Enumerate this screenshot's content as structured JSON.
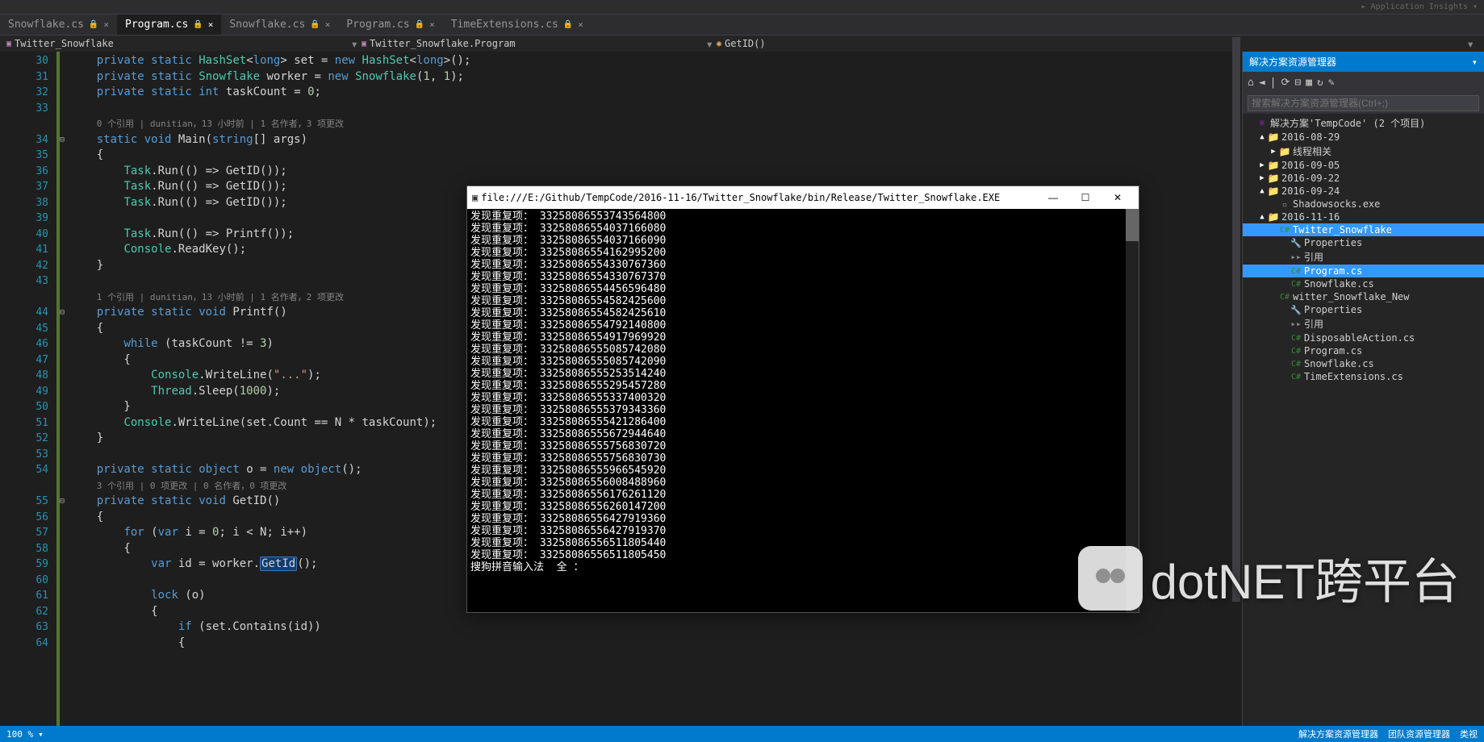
{
  "top_hint": "▸ Application Insights ▾",
  "tabs": [
    {
      "label": "Snowflake.cs",
      "active": false,
      "locked": true
    },
    {
      "label": "Program.cs",
      "active": true,
      "locked": true
    },
    {
      "label": "Snowflake.cs",
      "active": false,
      "locked": true
    },
    {
      "label": "Program.cs",
      "active": false,
      "locked": true
    },
    {
      "label": "TimeExtensions.cs",
      "active": false,
      "locked": true
    }
  ],
  "breadcrumb": {
    "left": "Twitter_Snowflake",
    "mid": "Twitter_Snowflake.Program",
    "right": "GetID()"
  },
  "code_lines": [
    {
      "n": 30,
      "html": "    <span class='kw'>private</span> <span class='kw'>static</span> <span class='type'>HashSet</span>&lt;<span class='kw'>long</span>&gt; set = <span class='kw'>new</span> <span class='type'>HashSet</span>&lt;<span class='kw'>long</span>&gt;();"
    },
    {
      "n": 31,
      "html": "    <span class='kw'>private</span> <span class='kw'>static</span> <span class='type'>Snowflake</span> worker = <span class='kw'>new</span> <span class='type'>Snowflake</span>(<span class='num'>1</span>, <span class='num'>1</span>);"
    },
    {
      "n": 32,
      "html": "    <span class='kw'>private</span> <span class='kw'>static</span> <span class='kw'>int</span> taskCount = <span class='num'>0</span>;"
    },
    {
      "n": 33,
      "html": ""
    },
    {
      "n": 0,
      "html": "    <span class='codelens'>0 个引用 | dunitian，13 小时前 | 1 名作者，3 项更改</span>"
    },
    {
      "n": 34,
      "html": "    <span class='kw'>static</span> <span class='kw'>void</span> Main(<span class='kw'>string</span>[] args)",
      "fold": "⊟"
    },
    {
      "n": 35,
      "html": "    {"
    },
    {
      "n": 36,
      "html": "        <span class='type'>Task</span>.Run(() =&gt; GetID());"
    },
    {
      "n": 37,
      "html": "        <span class='type'>Task</span>.Run(() =&gt; GetID());"
    },
    {
      "n": 38,
      "html": "        <span class='type'>Task</span>.Run(() =&gt; GetID());"
    },
    {
      "n": 39,
      "html": ""
    },
    {
      "n": 40,
      "html": "        <span class='type'>Task</span>.Run(() =&gt; Printf());"
    },
    {
      "n": 41,
      "html": "        <span class='type'>Console</span>.ReadKey();"
    },
    {
      "n": 42,
      "html": "    }"
    },
    {
      "n": 43,
      "html": ""
    },
    {
      "n": 0,
      "html": "    <span class='codelens'>1 个引用 | dunitian，13 小时前 | 1 名作者，2 项更改</span>"
    },
    {
      "n": 44,
      "html": "    <span class='kw'>private</span> <span class='kw'>static</span> <span class='kw'>void</span> Printf()",
      "fold": "⊟"
    },
    {
      "n": 45,
      "html": "    {"
    },
    {
      "n": 46,
      "html": "        <span class='kw'>while</span> (taskCount != <span class='num'>3</span>)"
    },
    {
      "n": 47,
      "html": "        {"
    },
    {
      "n": 48,
      "html": "            <span class='type'>Console</span>.WriteLine(<span class='str'>\"...\"</span>);"
    },
    {
      "n": 49,
      "html": "            <span class='type'>Thread</span>.Sleep(<span class='num'>1000</span>);"
    },
    {
      "n": 50,
      "html": "        }"
    },
    {
      "n": 51,
      "html": "        <span class='type'>Console</span>.WriteLine(set.Count == N * taskCount);"
    },
    {
      "n": 52,
      "html": "    }"
    },
    {
      "n": 53,
      "html": ""
    },
    {
      "n": 54,
      "html": "    <span class='kw'>private</span> <span class='kw'>static</span> <span class='kw'>object</span> o = <span class='kw'>new</span> <span class='kw'>object</span>();"
    },
    {
      "n": 0,
      "html": "    <span class='codelens'>3 个引用 | 0 项更改 | 0 名作者，0 项更改</span>"
    },
    {
      "n": 55,
      "html": "    <span class='kw'>private</span> <span class='kw'>static</span> <span class='kw'>void</span> GetID()",
      "fold": "⊟"
    },
    {
      "n": 56,
      "html": "    {"
    },
    {
      "n": 57,
      "html": "        <span class='kw'>for</span> (<span class='kw'>var</span> i = <span class='num'>0</span>; i &lt; N; i++)"
    },
    {
      "n": 58,
      "html": "        {"
    },
    {
      "n": 59,
      "html": "            <span class='kw'>var</span> id = worker.<span class='hl'>GetId</span>();"
    },
    {
      "n": 60,
      "html": ""
    },
    {
      "n": 61,
      "html": "            <span class='kw'>lock</span> (o)"
    },
    {
      "n": 62,
      "html": "            {"
    },
    {
      "n": 63,
      "html": "                <span class='kw'>if</span> (set.Contains(id))"
    },
    {
      "n": 64,
      "html": "                {"
    }
  ],
  "solution_panel": {
    "title": "解决方案资源管理器",
    "search_placeholder": "搜索解决方案资源管理器(Ctrl+;)",
    "tree": [
      {
        "depth": 0,
        "exp": "",
        "icon": "sln",
        "label": "解决方案'TempCode' (2 个项目)"
      },
      {
        "depth": 1,
        "exp": "▲",
        "icon": "folder",
        "label": "2016-08-29"
      },
      {
        "depth": 2,
        "exp": "▶",
        "icon": "folder",
        "label": "线程相关"
      },
      {
        "depth": 1,
        "exp": "▶",
        "icon": "folder",
        "label": "2016-09-05"
      },
      {
        "depth": 1,
        "exp": "▶",
        "icon": "folder",
        "label": "2016-09-22"
      },
      {
        "depth": 1,
        "exp": "▲",
        "icon": "folder",
        "label": "2016-09-24"
      },
      {
        "depth": 2,
        "exp": "",
        "icon": "file",
        "label": "Shadowsocks.exe"
      },
      {
        "depth": 1,
        "exp": "▲",
        "icon": "folder",
        "label": "2016-11-16"
      },
      {
        "depth": 2,
        "exp": "",
        "icon": "proj",
        "label": "Twitter_Snowflake",
        "sel": true
      },
      {
        "depth": 3,
        "exp": "",
        "icon": "wrench",
        "label": "Properties"
      },
      {
        "depth": 3,
        "exp": "",
        "icon": "ref",
        "label": "引用"
      },
      {
        "depth": 3,
        "exp": "",
        "icon": "cs",
        "label": "Program.cs",
        "sel2": true
      },
      {
        "depth": 3,
        "exp": "",
        "icon": "cs",
        "label": "Snowflake.cs"
      },
      {
        "depth": 2,
        "exp": "",
        "icon": "proj",
        "label": "witter_Snowflake_New"
      },
      {
        "depth": 3,
        "exp": "",
        "icon": "wrench",
        "label": "Properties"
      },
      {
        "depth": 3,
        "exp": "",
        "icon": "ref",
        "label": "引用"
      },
      {
        "depth": 3,
        "exp": "",
        "icon": "cs",
        "label": "DisposableAction.cs"
      },
      {
        "depth": 3,
        "exp": "",
        "icon": "cs",
        "label": "Program.cs"
      },
      {
        "depth": 3,
        "exp": "",
        "icon": "cs",
        "label": "Snowflake.cs"
      },
      {
        "depth": 3,
        "exp": "",
        "icon": "cs",
        "label": "TimeExtensions.cs"
      }
    ]
  },
  "console": {
    "title": "file:///E:/Github/TempCode/2016-11-16/Twitter_Snowflake/bin/Release/Twitter_Snowflake.EXE",
    "prefix": "发现重复项：",
    "ids": [
      "33258086553743564800",
      "33258086554037166080",
      "33258086554037166090",
      "33258086554162995200",
      "33258086554330767360",
      "33258086554330767370",
      "33258086554456596480",
      "33258086554582425600",
      "33258086554582425610",
      "33258086554792140800",
      "33258086554917969920",
      "33258086555085742080",
      "33258086555085742090",
      "33258086555253514240",
      "33258086555295457280",
      "33258086555337400320",
      "33258086555379343360",
      "33258086555421286400",
      "33258086555672944640",
      "33258086555756830720",
      "33258086555756830730",
      "33258086555966545920",
      "33258086556008488960",
      "33258086556176261120",
      "33258086556260147200",
      "33258086556427919360",
      "33258086556427919370",
      "33258086556511805440",
      "33258086556511805450"
    ],
    "ime": "搜狗拼音输入法  全 ："
  },
  "statusbar": {
    "zoom": "100 %",
    "right1": "解决方案资源管理器",
    "right2": "团队资源管理器",
    "right3": "类视"
  },
  "watermark": "dotNET跨平台"
}
